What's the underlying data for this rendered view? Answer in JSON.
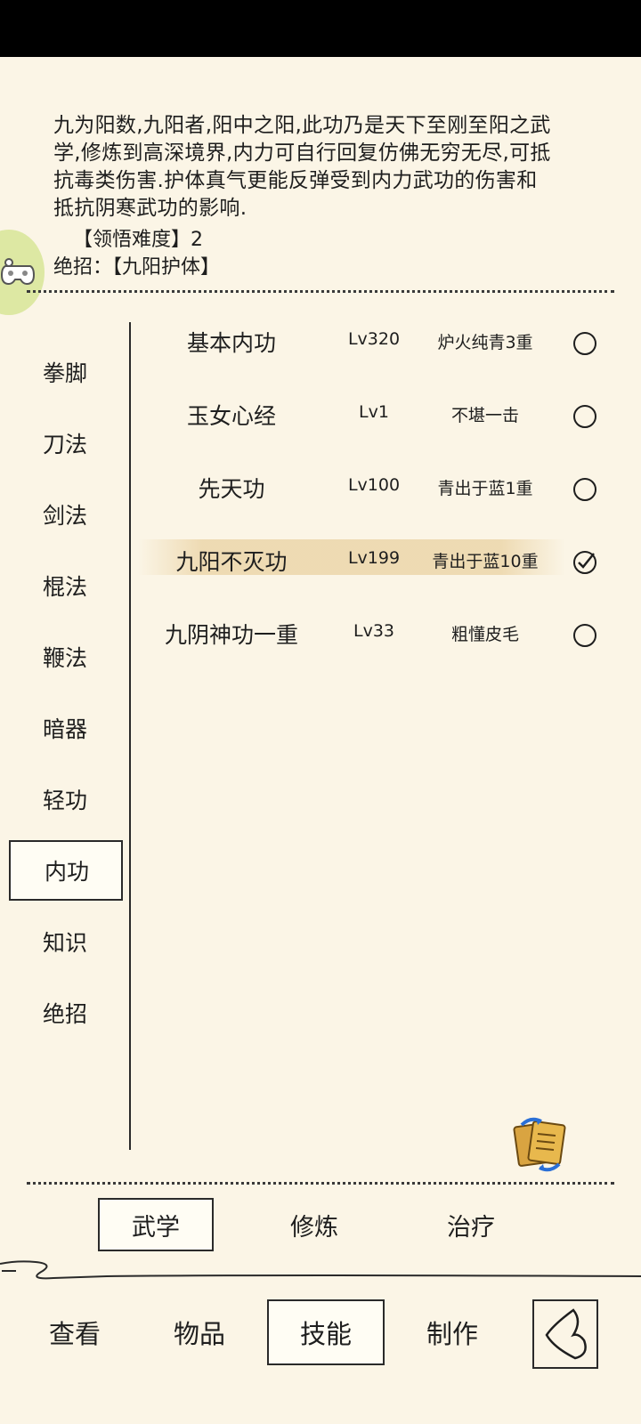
{
  "description": {
    "lines": [
      "九为阳数,九阳者,阳中之阳,此功乃是天下至刚至阳之武",
      "学,修炼到高深境界,内力可自行回复仿佛无穷无尽,可抵",
      "抗毒类伤害.护体真气更能反弹受到内力武功的伤害和",
      "抵抗阴寒武功的影响."
    ],
    "difficulty": "【领悟难度】2",
    "ultimate": "绝招：【九阳护体】"
  },
  "categories": [
    "拳脚",
    "刀法",
    "剑法",
    "棍法",
    "鞭法",
    "暗器",
    "轻功",
    "内功",
    "知识",
    "绝招"
  ],
  "active_category": "内功",
  "skills": [
    {
      "name": "基本内功",
      "level": "Lv320",
      "rank": "炉火纯青3重",
      "selected": false
    },
    {
      "name": "玉女心经",
      "level": "Lv1",
      "rank": "不堪一击",
      "selected": false
    },
    {
      "name": "先天功",
      "level": "Lv100",
      "rank": "青出于蓝1重",
      "selected": false
    },
    {
      "name": "九阳不灭功",
      "level": "Lv199",
      "rank": "青出于蓝10重",
      "selected": true
    },
    {
      "name": "九阴神功一重",
      "level": "Lv33",
      "rank": "粗懂皮毛",
      "selected": false
    }
  ],
  "subtabs": [
    "武学",
    "修炼",
    "治疗"
  ],
  "bottom_nav": [
    "查看",
    "物品",
    "技能",
    "制作"
  ],
  "icons": {
    "float_button": "gamepad-icon",
    "swap": "swap-manual-icon",
    "back": "back-arrow-icon",
    "radio": "radio-circle-icon",
    "check": "check-circle-icon"
  },
  "colors": {
    "background": "#fbf5e6",
    "ink": "#1e1e1e",
    "highlight": "#ecd6aa",
    "float_button": "#dde8a3"
  }
}
